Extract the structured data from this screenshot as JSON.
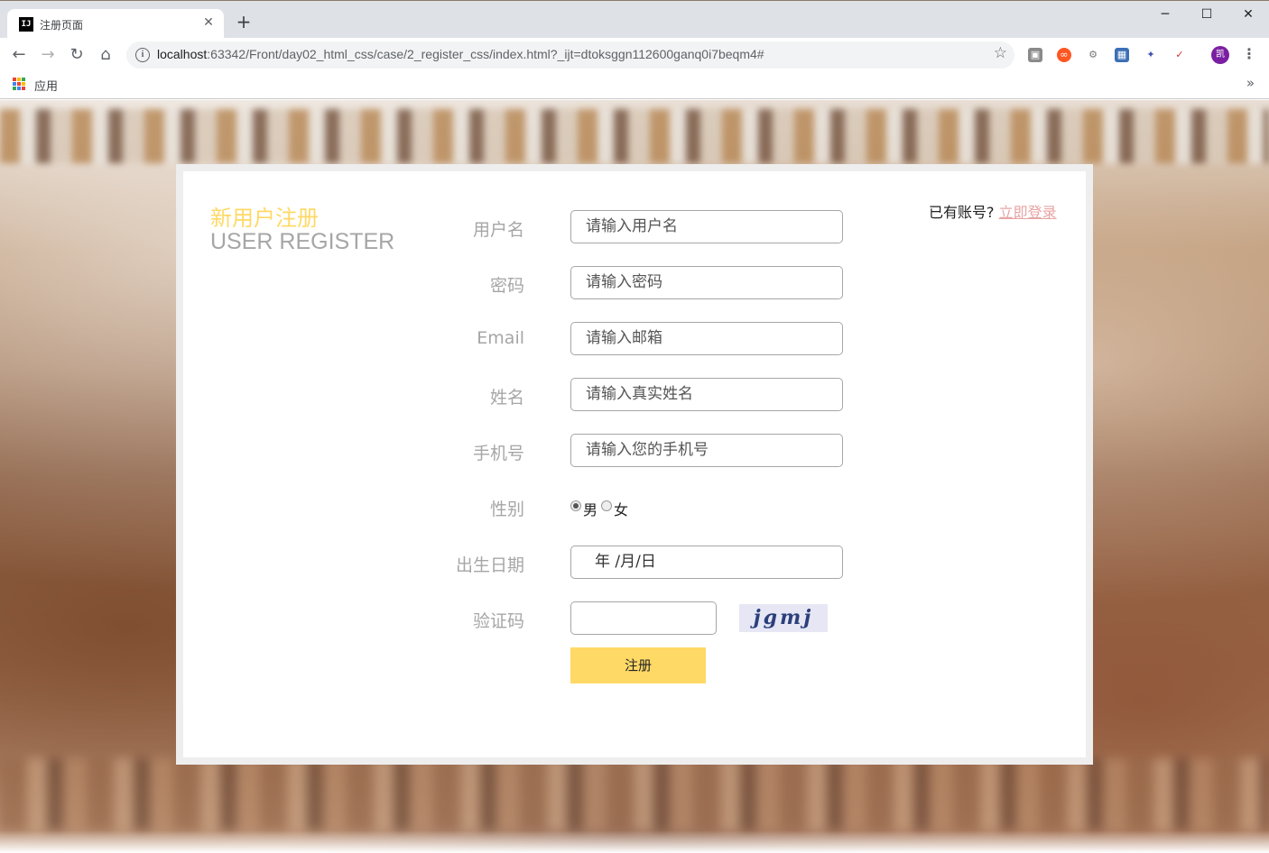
{
  "browser": {
    "tab_title": "注册页面",
    "favicon_text": "IJ",
    "url_host": "localhost",
    "url_rest": ":63342/Front/day02_html_css/case/2_register_css/index.html?_ijt=dtoksggn112600ganq0i7beqm4#",
    "bookmarks_apps_label": "应用",
    "avatar_text": "凯"
  },
  "form": {
    "title_cn": "新用户注册",
    "title_en": "USER REGISTER",
    "have_account_text": "已有账号?",
    "login_link": "立即登录",
    "fields": {
      "username": {
        "label": "用户名",
        "placeholder": "请输入用户名"
      },
      "password": {
        "label": "密码",
        "placeholder": "请输入密码"
      },
      "email": {
        "label": "Email",
        "placeholder": "请输入邮箱"
      },
      "realname": {
        "label": "姓名",
        "placeholder": "请输入真实姓名"
      },
      "phone": {
        "label": "手机号",
        "placeholder": "请输入您的手机号"
      },
      "gender": {
        "label": "性别",
        "male": "男",
        "female": "女",
        "selected": "男"
      },
      "birthday": {
        "label": "出生日期",
        "value": "年 /月/日"
      },
      "captcha": {
        "label": "验证码",
        "value": "",
        "image_text": "jgmj"
      }
    },
    "submit_label": "注册"
  },
  "colors": {
    "accent_yellow": "#ffd966",
    "label_gray": "#a6a6a6",
    "link_pink": "#e8a4a4"
  }
}
